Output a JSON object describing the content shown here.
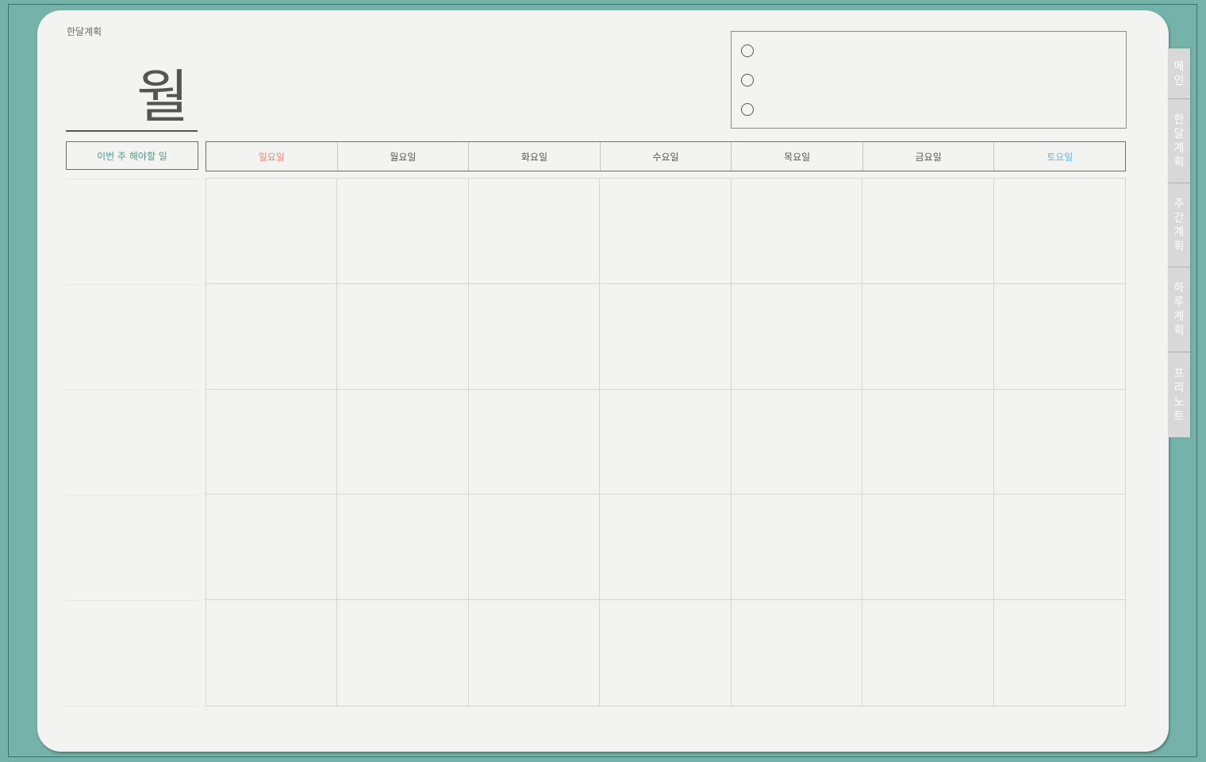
{
  "page": {
    "label": "한달계획",
    "month_word": "월"
  },
  "todo": {
    "header": "이번 주 해야할 일"
  },
  "weekdays": [
    "일요일",
    "월요일",
    "화요일",
    "수요일",
    "목요일",
    "금요일",
    "토요일"
  ],
  "tabs": [
    {
      "label": "메인"
    },
    {
      "label": "한달계획"
    },
    {
      "label": "주간계획"
    },
    {
      "label": "하루계획"
    },
    {
      "label": "프리노트"
    }
  ],
  "colors": {
    "background": "#74b2aa",
    "paper": "#f3f3f1",
    "sunday": "#e98b80",
    "saturday": "#6db3df",
    "accent": "#4a9d90",
    "tab": "#d8d8d8"
  }
}
